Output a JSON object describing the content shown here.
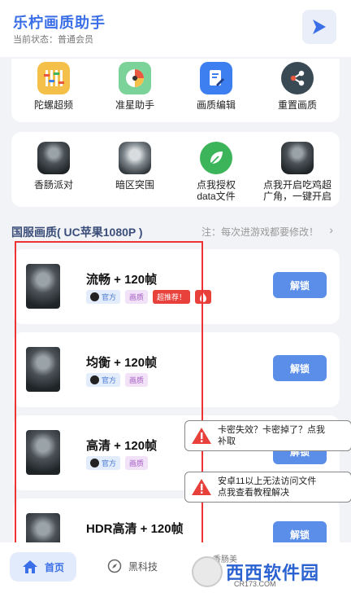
{
  "header": {
    "title": "乐柠画质助手",
    "status": "当前状态：普通会员"
  },
  "tools_row1": [
    {
      "label": "陀螺超频",
      "icon": "gyroscope-sliders-icon",
      "color": "#f5c04a"
    },
    {
      "label": "准星助手",
      "icon": "crosshair-pie-icon",
      "color": "#7bd39a"
    },
    {
      "label": "画质编辑",
      "icon": "edit-document-icon",
      "color": "#3d7ef0"
    },
    {
      "label": "重置画质",
      "icon": "share-nodes-icon",
      "color": "#3a4a55"
    }
  ],
  "tools_row2": [
    {
      "label": "香肠派对"
    },
    {
      "label": "暗区突围"
    },
    {
      "label": "点我授权\ndata文件",
      "icon": "leaf-icon",
      "color": "#3cb45a"
    },
    {
      "label": "点我开启吃鸡超\n广角，一键开启"
    }
  ],
  "section": {
    "title": "国服画质( UC苹果1080P )",
    "note": "注：每次进游戏都要修改！"
  },
  "items": [
    {
      "name": "流畅 + 120帧",
      "tags": [
        "官方",
        "画质",
        "超推荐！"
      ],
      "button": "解锁"
    },
    {
      "name": "均衡 + 120帧",
      "tags": [
        "官方",
        "画质"
      ],
      "button": "解锁"
    },
    {
      "name": "高清 + 120帧",
      "tags": [
        "官方",
        "画质"
      ],
      "button": "解锁"
    },
    {
      "name": "HDR高清 + 120帧",
      "tags": [],
      "button": "解锁"
    }
  ],
  "toasts": [
    {
      "text": "卡密失效？卡密掉了？点我\n补取"
    },
    {
      "text": "安卓11以上无法访问文件\n点我查看教程解决"
    }
  ],
  "nav": {
    "home": "首页",
    "tech": "黑科技",
    "partial": "香肠美"
  },
  "watermark": {
    "main": "西西软件园",
    "sub": "CR173.COM"
  }
}
